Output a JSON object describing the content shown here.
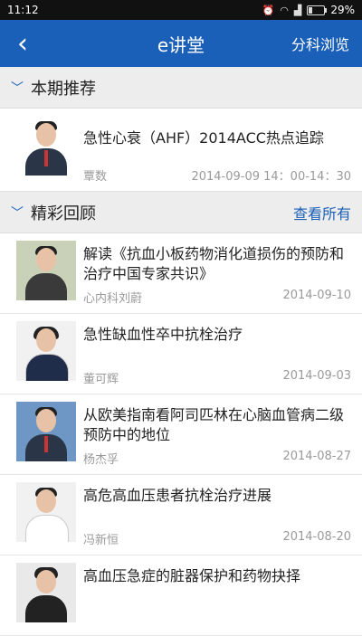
{
  "status": {
    "time": "11:12",
    "battery": "29%"
  },
  "header": {
    "title": "e讲堂",
    "browse_label": "分科浏览"
  },
  "featured_section": {
    "label": "本期推荐"
  },
  "featured": {
    "title": "急性心衰（AHF）2014ACC热点追踪",
    "author": "覃数",
    "time": "2014-09-09 14：00-14：30"
  },
  "review_section": {
    "label": "精彩回顾",
    "more_label": "查看所有"
  },
  "items": [
    {
      "title": "解读《抗血小板药物消化道损伤的预防和治疗中国专家共识》",
      "author": "心内科刘蔚",
      "date": "2014-09-10"
    },
    {
      "title": "急性缺血性卒中抗栓治疗",
      "author": "董可辉",
      "date": "2014-09-03"
    },
    {
      "title": "从欧美指南看阿司匹林在心脑血管病二级预防中的地位",
      "author": "杨杰孚",
      "date": "2014-08-27"
    },
    {
      "title": "高危高血压患者抗栓治疗进展",
      "author": "冯新恒",
      "date": "2014-08-20"
    },
    {
      "title": "高血压急症的脏器保护和药物抉择",
      "author": "",
      "date": ""
    }
  ]
}
